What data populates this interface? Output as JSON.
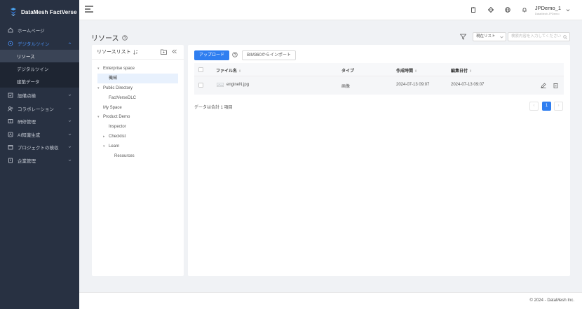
{
  "brand": {
    "name": "DataMesh FactVerse",
    "accent": "#2f7ef0"
  },
  "sidebar": {
    "items": [
      {
        "label": "ホームページ",
        "icon": "home-icon",
        "active": false,
        "chevron": false
      },
      {
        "label": "デジタルツイン",
        "icon": "digital-twin-icon",
        "active": true,
        "chevron": true
      },
      {
        "label": "設備点検",
        "icon": "inspection-icon",
        "active": false,
        "chevron": true
      },
      {
        "label": "コラボレーション",
        "icon": "collaboration-icon",
        "active": false,
        "chevron": true
      },
      {
        "label": "研修管理",
        "icon": "training-icon",
        "active": false,
        "chevron": true
      },
      {
        "label": "AI知識生成",
        "icon": "ai-icon",
        "active": false,
        "chevron": true
      },
      {
        "label": "プロジェクトの検収",
        "icon": "project-icon",
        "active": false,
        "chevron": true
      },
      {
        "label": "企業管理",
        "icon": "enterprise-icon",
        "active": false,
        "chevron": true
      }
    ],
    "subitems": [
      {
        "label": "リソース",
        "active": true
      },
      {
        "label": "デジタルツイン",
        "active": false
      },
      {
        "label": "建築データ",
        "active": false
      }
    ]
  },
  "topbar": {
    "user_name": "JPDemo_1",
    "user_sub": "DataMesh JPDemo",
    "icons": [
      "clipboard-icon",
      "cube-icon",
      "globe-icon",
      "bell-icon"
    ]
  },
  "page": {
    "title": "リソース"
  },
  "toolbar": {
    "filter_select": "現在リスト",
    "search_placeholder": "検索内容を入力してください"
  },
  "tree": {
    "header": "リソースリスト",
    "nodes": [
      {
        "label": "Enterprise space",
        "arrow": "▾"
      },
      {
        "label": "機械",
        "arrow": ""
      },
      {
        "label": "Public Directory",
        "arrow": "▾"
      },
      {
        "label": "FactVerseDLC",
        "arrow": ""
      },
      {
        "label": "My Space",
        "arrow": ""
      },
      {
        "label": "Product Demo",
        "arrow": "▾"
      },
      {
        "label": "Inspector",
        "arrow": ""
      },
      {
        "label": "Checklist",
        "arrow": "▸"
      },
      {
        "label": "Learn",
        "arrow": "▾"
      },
      {
        "label": "Resources",
        "arrow": ""
      }
    ]
  },
  "actions": {
    "upload": "アップロード",
    "import": "BIM360からインポート"
  },
  "table": {
    "columns": [
      "ファイル名",
      "タイプ",
      "作成時間",
      "編集日付"
    ],
    "rows": [
      {
        "name": "engineN.jpg",
        "type": "画像",
        "created": "2024-07-13 09:07",
        "edited": "2024-07-13 09:07"
      }
    ],
    "total": "データは合計 1 項目"
  },
  "pagination": {
    "prev": "‹",
    "current": "1",
    "next": "›"
  },
  "footer": {
    "copyright": "© 2024 - DataMesh Inc."
  }
}
